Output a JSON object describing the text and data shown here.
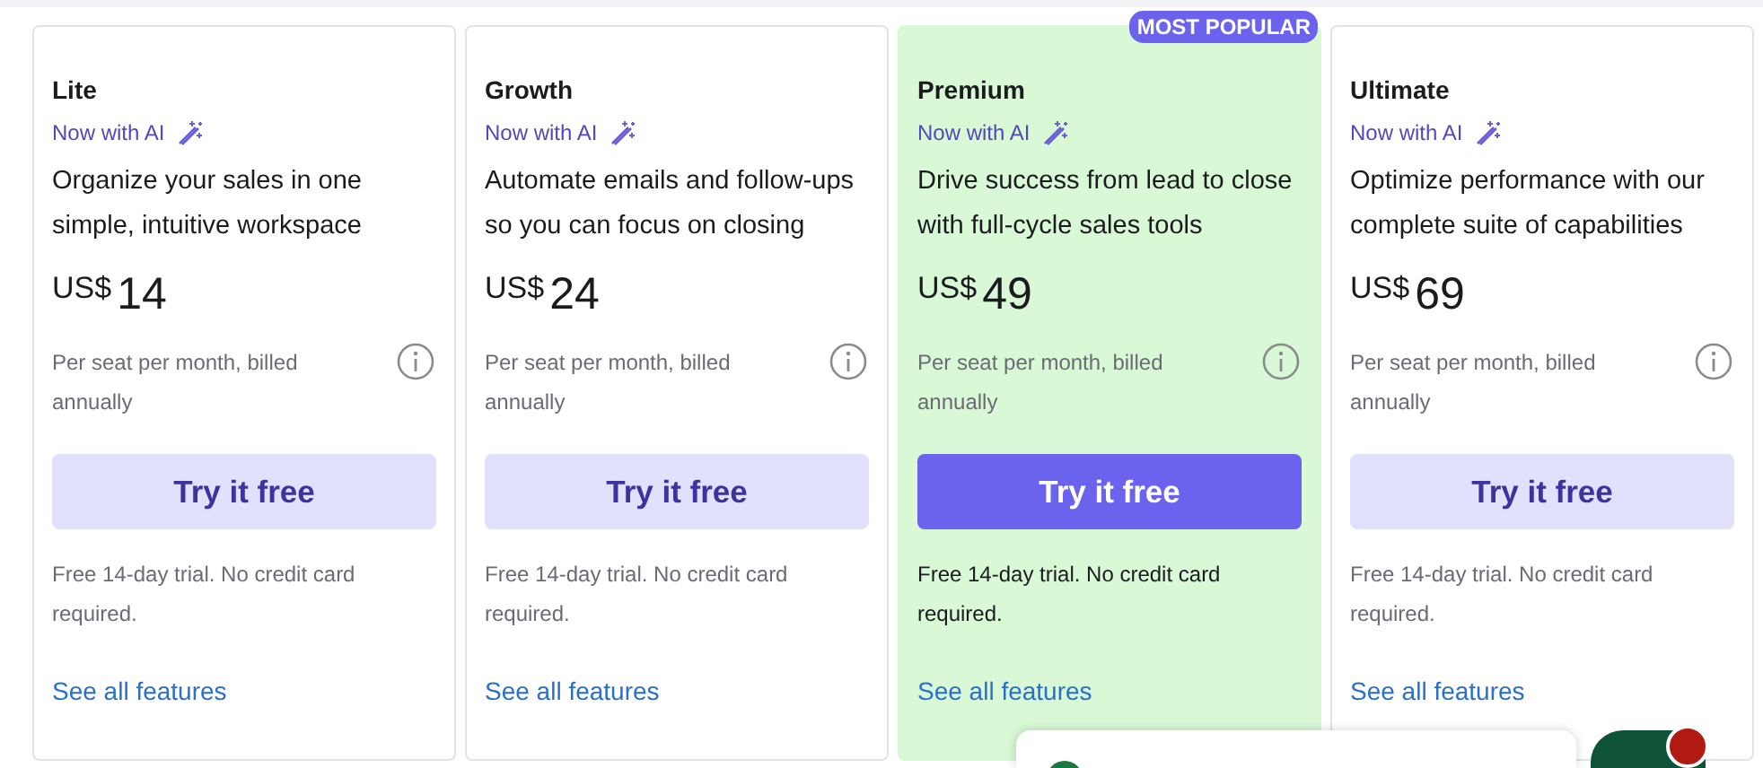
{
  "plans": [
    {
      "name": "Lite",
      "ai_label": "Now with AI",
      "description": "Organize your sales in one simple, intuitive workspace",
      "currency": "US$",
      "price": "14",
      "billing": "Per seat per month, billed annually",
      "cta": "Try it free",
      "trial_note": "Free 14-day trial. No credit card required.",
      "features_link": "See all features",
      "featured": false
    },
    {
      "name": "Growth",
      "ai_label": "Now with AI",
      "description": "Automate emails and follow-ups so you can focus on closing",
      "currency": "US$",
      "price": "24",
      "billing": "Per seat per month, billed annually",
      "cta": "Try it free",
      "trial_note": "Free 14-day trial. No credit card required.",
      "features_link": "See all features",
      "featured": false
    },
    {
      "name": "Premium",
      "badge": "MOST POPULAR",
      "ai_label": "Now with AI",
      "description": "Drive success from lead to close with full-cycle sales tools",
      "currency": "US$",
      "price": "49",
      "billing": "Per seat per month, billed annually",
      "cta": "Try it free",
      "trial_note": "Free 14-day trial. No credit card required.",
      "features_link": "See all features",
      "featured": true
    },
    {
      "name": "Ultimate",
      "ai_label": "Now with AI",
      "description": "Optimize performance with our complete suite of capabilities",
      "currency": "US$",
      "price": "69",
      "billing": "Per seat per month, billed annually",
      "cta": "Try it free",
      "trial_note": "Free 14-day trial. No credit card required.",
      "features_link": "See all features",
      "featured": false
    }
  ],
  "chat_widget": {
    "unread": true
  }
}
